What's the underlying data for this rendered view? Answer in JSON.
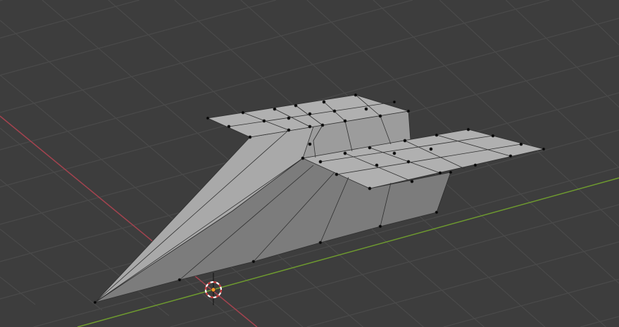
{
  "viewport": {
    "mode": "edit-mode",
    "colors": {
      "background": "#3d3d3d",
      "grid": "#4a4a4a",
      "x_axis": "#a3434f",
      "y_axis": "#6e9a2f",
      "face_light": "#a8a8a8",
      "face_mid": "#8e8e8e",
      "face_dark": "#7a7a7a",
      "edge": "#303030",
      "vertex": "#000000",
      "cursor_red": "#c43a3a",
      "cursor_white": "#ffffff",
      "origin": "#f39a2a"
    },
    "icons": [
      "3d-cursor-icon",
      "object-origin-icon"
    ]
  }
}
